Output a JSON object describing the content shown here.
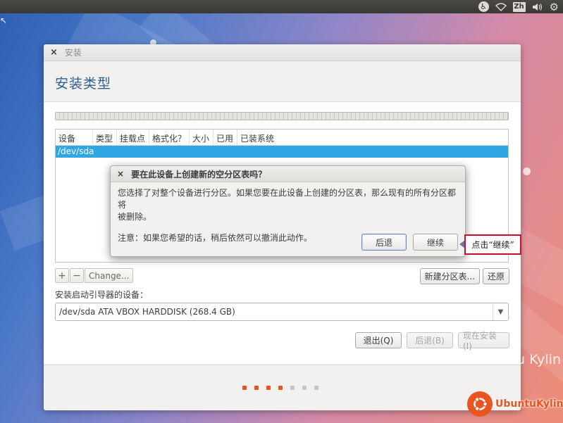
{
  "top_panel": {
    "accessibility_icon": "accessibility-icon",
    "network_icon": "wifi-icon",
    "language": "Zh",
    "volume_icon": "volume-icon",
    "settings_icon": "gear-icon"
  },
  "window": {
    "title": "安装",
    "heading": "安装类型",
    "table": {
      "columns": [
        "设备",
        "类型",
        "挂载点",
        "格式化？",
        "大小",
        "已用",
        "已装系统"
      ],
      "selected_row": "/dev/sda"
    },
    "tools": {
      "add": "+",
      "remove": "−",
      "change": "Change..."
    },
    "new_table_button": "新建分区表...",
    "revert_button": "还原",
    "bootloader_label": "安装启动引导器的设备：",
    "bootloader_value": "/dev/sda  ATA VBOX HARDDISK (268.4 GB)",
    "quit_button": "退出(Q)",
    "back_button": "后退(B)",
    "install_button": "现在安装(I)",
    "progress": {
      "total_steps": 7,
      "completed_steps": 4,
      "active_color": "#e95420",
      "inactive_color": "#c8c6c2"
    }
  },
  "dialog": {
    "title": "要在此设备上创建新的空分区表吗？",
    "body_line1": "您选择了对整个设备进行分区。如果您要在此设备上创建的分区表，那么现有的所有分区都将",
    "body_line2": "被删除。",
    "note": "注意：如果您希望的话，稍后依然可以撤消此动作。",
    "back_button": "后退",
    "continue_button": "继续"
  },
  "callout": {
    "text": "点击“继续”"
  },
  "branding": {
    "background_text": "u Kylin",
    "name": "UbuntuKylin"
  },
  "colors": {
    "accent": "#e95420",
    "selection": "#30a7e4",
    "callout_border": "#c8102e"
  }
}
